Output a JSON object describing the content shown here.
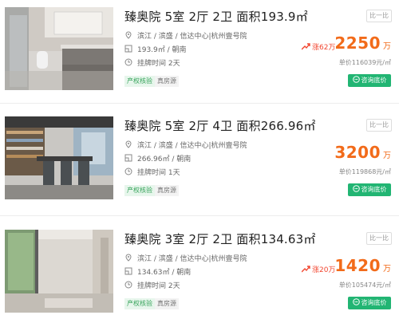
{
  "listings": [
    {
      "title": "臻奥院 5室 2厅 2卫 面积193.9㎡",
      "location": "滨江 / 滨盛 / 信达中心|杭州壹号院",
      "spec": "193.9㎡ / 朝南",
      "listed": "挂牌时间 2天",
      "tags": [
        "产权核验",
        "真房源"
      ],
      "compare": "比一比",
      "trend": "涨62万",
      "price": "2250",
      "price_unit": "万",
      "unit_price": "单价116039元/㎡",
      "ask": "咨询底价"
    },
    {
      "title": "臻奥院 5室 2厅 4卫 面积266.96㎡",
      "location": "滨江 / 滨盛 / 信达中心|杭州壹号院",
      "spec": "266.96㎡ / 朝南",
      "listed": "挂牌时间 1天",
      "tags": [
        "产权核验",
        "真房源"
      ],
      "compare": "比一比",
      "trend": "",
      "price": "3200",
      "price_unit": "万",
      "unit_price": "单价119868元/㎡",
      "ask": "咨询底价"
    },
    {
      "title": "臻奥院 3室 2厅 2卫 面积134.63㎡",
      "location": "滨江 / 滨盛 / 信达中心|杭州壹号院",
      "spec": "134.63㎡ / 朝南",
      "listed": "挂牌时间 2天",
      "tags": [
        "产权核验",
        "真房源"
      ],
      "compare": "比一比",
      "trend": "涨20万",
      "price": "1420",
      "price_unit": "万",
      "unit_price": "单价105474元/㎡",
      "ask": "咨询底价"
    }
  ],
  "colors": {
    "price": "#f26b1a",
    "trend": "#f2452f",
    "ask_button": "#22b573",
    "verify_tag": "#36a35a"
  },
  "icons": {
    "location": "map-pin-icon",
    "spec": "floorplan-icon",
    "time": "clock-icon",
    "trend": "trend-up-icon",
    "ask": "chat-bubble-icon"
  }
}
